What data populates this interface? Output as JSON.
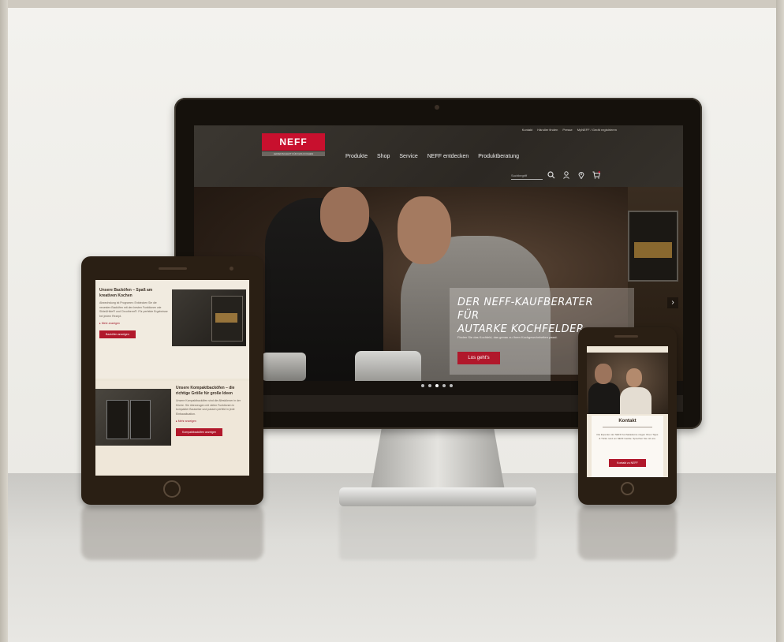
{
  "desktop": {
    "logo_text": "NEFF",
    "logo_tagline": "LEIDENSCHAFT FÜR DAS KOCHEN",
    "utility_links": [
      "Kontakt",
      "Händler finden",
      "Presse",
      "MyNEFF / Gerät registrieren"
    ],
    "main_nav": [
      "Produkte",
      "Shop",
      "Service",
      "NEFF entdecken",
      "Produktberatung"
    ],
    "search_placeholder": "Suchbegriff",
    "icons": [
      "search-icon",
      "user-icon",
      "location-pin-icon",
      "cart-icon"
    ],
    "hero": {
      "title_line1": "DER NEFF-KAUFBERATER FÜR",
      "title_line2": "AUTARKE KOCHFELDER",
      "text": "Finden Sie das Kochfeld, das genau zu Ihren Kochgewohnheiten passt.",
      "button": "Los geht's",
      "next_arrow": "›",
      "slides": 5,
      "active_slide": 2
    }
  },
  "tablet": {
    "section1": {
      "title": "Unsere Backöfen – Spaß am kreativen Kochen",
      "body": "Abwechslung ist Programm: Entdecken Sie die neuesten Backöfen mit den besten Funktionen wie Slide&Hide® und Circotherm®. Für perfekte Ergebnisse bei jedem Rezept.",
      "link": "▸ Mehr anzeigen",
      "button": "Backöfen anzeigen"
    },
    "section2": {
      "title": "Unsere Kompaktbacköfen – die richtige Größe für große Ideen",
      "body": "Unsere Kompaktbacköfen sind die Alleskönner in der Küche. Sie überzeugen mit vielen Funktionen in kompakter Bauweise und passen perfekt in jede Einbausituation.",
      "link": "▸ Mehr anzeigen",
      "button": "Kompaktbacköfen anzeigen"
    }
  },
  "phone": {
    "title": "Kontakt",
    "text": "Die Experten der NEFF Kochakademie zeigen Ihnen Tipps & Tricks rund um NEFF Geräte. Sprechen Sie mit uns.",
    "button": "Kontakt zu NEFF"
  },
  "colors": {
    "brand_red": "#c8102e",
    "button_red": "#b1182b",
    "device_bezel": "#2a1f14"
  }
}
